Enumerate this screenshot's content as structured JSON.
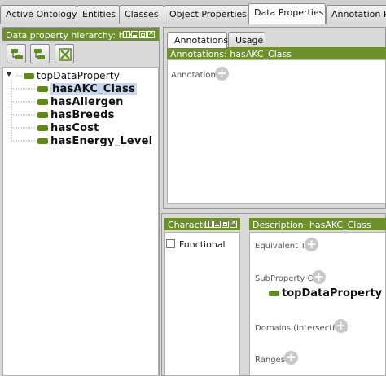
{
  "tabs": [
    {
      "label": "Active Ontology",
      "active": false
    },
    {
      "label": "Entities",
      "active": false
    },
    {
      "label": "Classes",
      "active": false
    },
    {
      "label": "Object Properties",
      "active": false
    },
    {
      "label": "Data Properties",
      "active": true
    },
    {
      "label": "Annotation Pr",
      "active": false
    }
  ],
  "hierarchy": {
    "title": "Data property hierarchy: has",
    "toolbar": {
      "add_sub_icon": "add-subproperty-icon",
      "add_sibling_icon": "add-sibling-property-icon",
      "delete_icon": "delete-property-icon"
    },
    "root": "topDataProperty",
    "items": [
      "hasAKC_Class",
      "hasAllergen",
      "hasBreeds",
      "hasCost",
      "hasEnergy_Level"
    ],
    "selected": "hasAKC_Class"
  },
  "annotations": {
    "tabs": [
      "Annotations",
      "Usage"
    ],
    "header": "Annotations: hasAKC_Class",
    "label": "Annotations"
  },
  "characteristics": {
    "header": "Characte",
    "items": [
      {
        "label": "Functional",
        "checked": false
      }
    ]
  },
  "description": {
    "header": "Description: hasAKC_Class",
    "equivalent_to": "Equivalent To",
    "subproperty_of": "SubProperty Of",
    "subproperty_value": "topDataProperty",
    "domains": "Domains (intersection)",
    "ranges": "Ranges"
  },
  "colors": {
    "header_green": "#6d8f2c",
    "property_icon": "#5f8a1f",
    "selection": "#c9d8ef"
  }
}
